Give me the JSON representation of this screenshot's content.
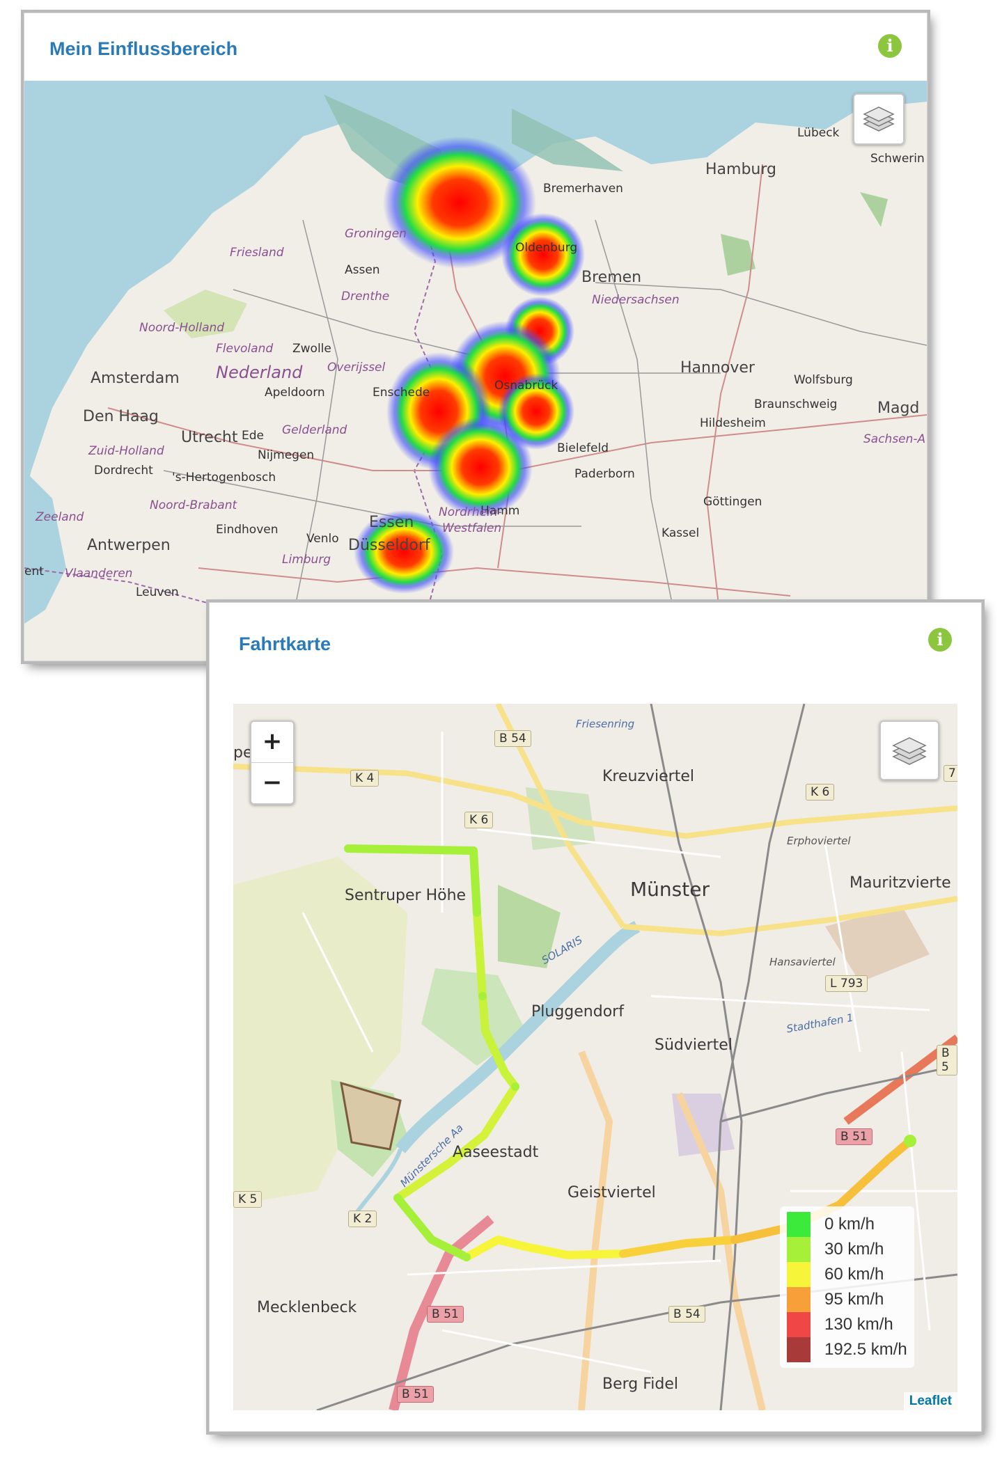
{
  "panel1": {
    "title": "Mein Einflussbereich",
    "info_icon": "i",
    "map_labels": [
      "Lübeck",
      "Schwerin",
      "Hamburg",
      "Bremerhaven",
      "Groningen",
      "Oldenburg",
      "Bremen",
      "Friesland",
      "Assen",
      "Drenthe",
      "Niedersachsen",
      "Noord-Holland",
      "Flevoland",
      "Zwolle",
      "Amsterdam",
      "Nederland",
      "Overijssel",
      "Hannover",
      "Wolfsburg",
      "Apeldoorn",
      "Enschede",
      "Osnabrück",
      "Braunschweig",
      "Magd",
      "Den Haag",
      "Utrecht",
      "Ede",
      "Gelderland",
      "Hildesheim",
      "Sachsen-A",
      "Zuid-Holland",
      "Nijmegen",
      "Bielefeld",
      "Dordrecht",
      "'s-Hertogenbosch",
      "Paderborn",
      "Hamm",
      "Noord-Brabant",
      "Nordrhein-",
      "Westfalen",
      "Göttingen",
      "Zeeland",
      "Essen",
      "Eindhoven",
      "Kassel",
      "Antwerpen",
      "Venlo",
      "Düsseldorf",
      "Limburg",
      "Vlaanderen",
      "ent",
      "Leuven"
    ]
  },
  "panel2": {
    "title": "Fahrtkarte",
    "info_icon": "i",
    "zoom_in": "+",
    "zoom_out": "−",
    "attribution": "Leaflet",
    "map_labels": [
      "Friesenring",
      "Kreuzviertel",
      "Sentruper Höhe",
      "Münster",
      "Mauritzvierte",
      "Erphoviertel",
      "Hansaviertel",
      "Pluggendorf",
      "Südviertel",
      "Stadthafen 1",
      "Aaseestadt",
      "Geistviertel",
      "Mecklenbeck",
      "Berg Fidel",
      "SOLARIS",
      "Münstersche Aa",
      "pe"
    ],
    "road_shields": [
      "B 54",
      "K 4",
      "K 6",
      "K 6",
      "7",
      "L 793",
      "B 5",
      "B 51",
      "K 5",
      "K 2",
      "B 51",
      "B 54",
      "B 51"
    ],
    "legend": [
      {
        "label": "0 km/h",
        "color": "#3bea3b"
      },
      {
        "label": "30 km/h",
        "color": "#a6f03a"
      },
      {
        "label": "60 km/h",
        "color": "#f7f53a"
      },
      {
        "label": "95 km/h",
        "color": "#f7a03a"
      },
      {
        "label": "130 km/h",
        "color": "#f04646"
      },
      {
        "label": "192.5 km/h",
        "color": "#a83a3a"
      }
    ]
  }
}
